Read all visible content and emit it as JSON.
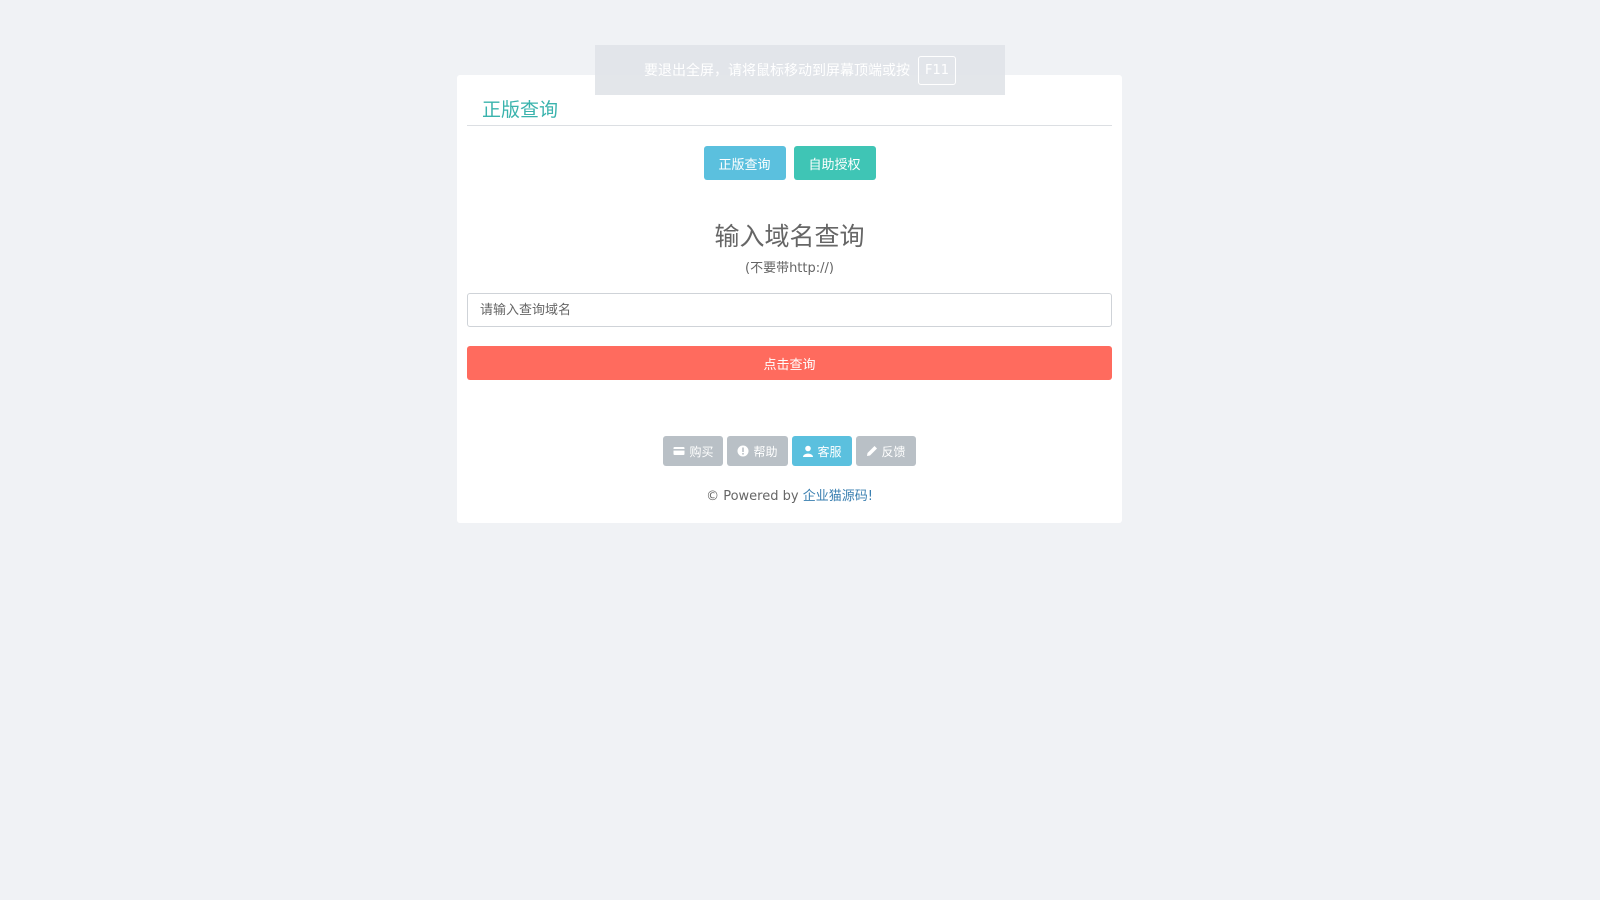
{
  "panel": {
    "title": "正版查询",
    "tabs": [
      {
        "label": "正版查询"
      },
      {
        "label": "自助授权"
      }
    ],
    "heading": "输入域名查询",
    "subnote": "(不要带http://)",
    "search": {
      "placeholder": "请输入查询域名",
      "value": ""
    },
    "query_button": "点击查询",
    "footer_buttons": [
      {
        "label": "购买",
        "icon": "credit-card-icon"
      },
      {
        "label": "帮助",
        "icon": "info-circle-icon"
      },
      {
        "label": "客服",
        "icon": "user-icon"
      },
      {
        "label": "反馈",
        "icon": "pencil-icon"
      }
    ],
    "powered_prefix": "© Powered by ",
    "powered_link": "企业猫源码!"
  },
  "fullscreen_toast": {
    "message": "要退出全屏，请将鼠标移动到屏幕顶端或按",
    "key": "F11"
  },
  "colors": {
    "background": "#f0f2f5",
    "title": "#3ab3ad",
    "info": "#5bc0de",
    "teal": "#3fc5b5",
    "danger": "#ff6b5e",
    "muted": "#b9c0c6",
    "link": "#3a7fb0"
  }
}
